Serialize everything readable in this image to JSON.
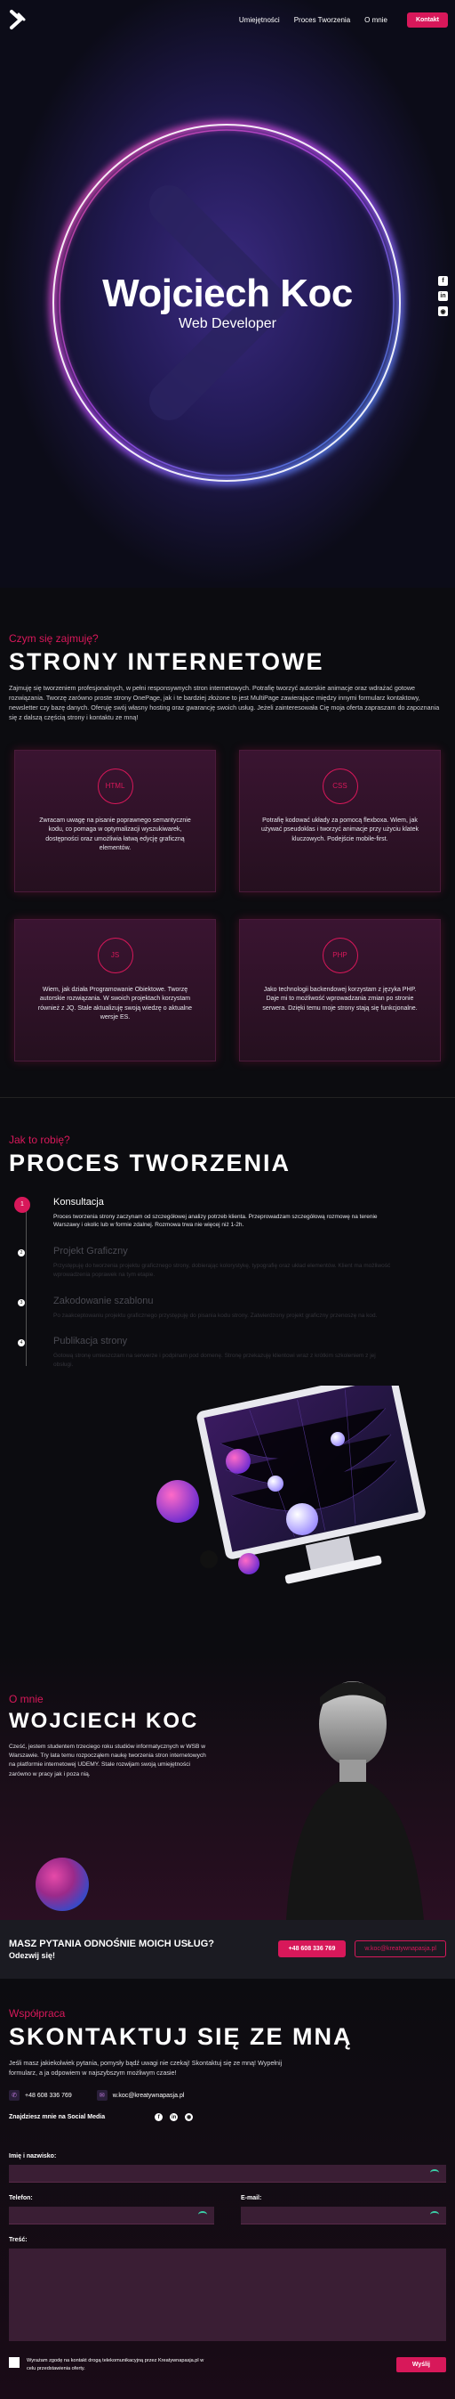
{
  "nav": {
    "links": [
      "Umiejętności",
      "Proces Tworzenia",
      "O mnie"
    ],
    "contact_button": "Kontakt"
  },
  "hero": {
    "title": "Wojciech Koc",
    "subtitle": "Web Developer",
    "social_icons": [
      "facebook-icon",
      "linkedin-icon",
      "github-icon"
    ]
  },
  "services": {
    "kicker": "Czym się zajmuję?",
    "title": "STRONY INTERNETOWE",
    "intro": "Zajmuję się tworzeniem profesjonalnych, w pełni responsywnych stron internetowych. Potrafię tworzyć autorskie animacje oraz wdrażać gotowe rozwiązania. Tworzę zarówno proste strony OnePage, jak i te bardziej złożone to jest MultiPage zawierające między innymi formularz kontaktowy, newsletter czy bazę danych. Oferuję swój własny hosting oraz gwarancję swoich usług. Jeżeli zainteresowała Cię moja oferta zapraszam do zapoznania się z dalszą częścią strony i kontaktu ze mną!",
    "cards": [
      {
        "badge": "HTML",
        "text": "Zwracam uwagę na pisanie poprawnego semantycznie kodu, co pomaga w optymalizacji wyszukiwarek, dostępności oraz umożliwia łatwą edycję graficzną elementów."
      },
      {
        "badge": "CSS",
        "text": "Potrafię kodować układy za pomocą flexboxa. Wiem, jak używać pseudoklas i tworzyć animacje przy użyciu klatek kluczowych. Podejście mobile-first."
      },
      {
        "badge": "JS",
        "text": "Wiem, jak działa Programowanie Obiektowe. Tworzę autorskie rozwiązania. W swoich projektach korzystam również z JQ. Stale aktualizuję swoją wiedzę o aktualne wersje ES."
      },
      {
        "badge": "PHP",
        "text": "Jako technologii backendowej korzystam z języka PHP. Daje mi to możliwość wprowadzania zmian po stronie serwera. Dzięki temu moje strony stają się funkcjonalne."
      }
    ]
  },
  "process": {
    "kicker": "Jak to robię?",
    "title": "PROCES TWORZENIA",
    "steps": [
      {
        "num": "1",
        "title": "Konsultacja",
        "text": "Proces tworzenia strony zaczynam od szczegółowej analizy potrzeb klienta. Przeprowadzam szczegółową rozmowę na terenie Warszawy i okolic lub w formie zdalnej. Rozmowa trwa nie więcej niż 1-2h."
      },
      {
        "num": "2",
        "title": "Projekt Graficzny",
        "text": "Przystępuję do tworzenia projektu graficznego strony, dobierając kolorystykę, typografię oraz układ elementów. Klient ma możliwość wprowadzenia poprawek na tym etapie."
      },
      {
        "num": "3",
        "title": "Zakodowanie szablonu",
        "text": "Po zaakceptowaniu projektu graficznego przystępuję do pisania kodu strony. Zatwierdzony projekt graficzny przenoszę na kod."
      },
      {
        "num": "4",
        "title": "Publikacja strony",
        "text": "Gotową stronę umieszczam na serwerze i podpinam pod domenę. Stronę przekazuję klientowi wraz z krótkim szkoleniem z jej obsługi."
      }
    ]
  },
  "about": {
    "kicker": "O mnie",
    "title": "WOJCIECH KOC",
    "text": "Cześć, jestem studentem trzeciego roku studiów informatycznych w WSB w Warszawie. Try lata temu rozpocząłem naukę tworzenia stron internetowych na platformie internetowej UDEMY. Stale rozwijam swoją umiejętności zarówno w pracy jak i poza nią."
  },
  "cta": {
    "question": "MASZ PYTANIA ODNOŚNIE MOICH USŁUG?",
    "sub": "Odezwij się!",
    "phone": "+48 608 336 769",
    "email": "w.koc@kreatywnapasja.pl"
  },
  "contact": {
    "kicker": "Współpraca",
    "title": "SKONTAKTUJ SIĘ ZE MNĄ",
    "intro": "Jeśli masz jakiekolwiek pytania, pomysły bądź uwagi nie czekaj! Skontaktuj się ze mną! Wypełnij formularz, a ja odpowiem w najszybszym możliwym czasie!",
    "phone": "+48 608 336 769",
    "email": "w.koc@kreatywnapasja.pl",
    "social_label": "Znajdziesz mnie na Social Media",
    "form": {
      "name_label": "Imię i nazwisko:",
      "phone_label": "Telefon:",
      "email_label": "E-mail:",
      "message_label": "Treść:",
      "agree_text": "Wyrażam zgodę na kontakt drogą telekomunikacyjną przez Kreatywnapasja.pl w celu przedstawienia oferty.",
      "send_label": "Wyślij"
    }
  }
}
